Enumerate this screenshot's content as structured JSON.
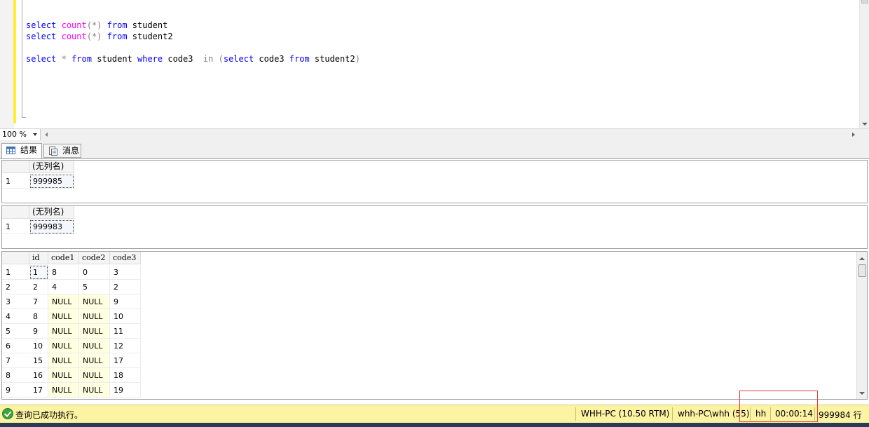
{
  "editor": {
    "lines": [
      [
        {
          "t": "select",
          "c": "kw"
        },
        {
          "t": " ",
          "c": "id"
        },
        {
          "t": "count",
          "c": "fn"
        },
        {
          "t": "(*)",
          "c": "op"
        },
        {
          "t": " ",
          "c": "id"
        },
        {
          "t": "from",
          "c": "kw"
        },
        {
          "t": " student",
          "c": "id"
        }
      ],
      [
        {
          "t": "select",
          "c": "kw"
        },
        {
          "t": " ",
          "c": "id"
        },
        {
          "t": "count",
          "c": "fn"
        },
        {
          "t": "(*)",
          "c": "op"
        },
        {
          "t": " ",
          "c": "id"
        },
        {
          "t": "from",
          "c": "kw"
        },
        {
          "t": " student2",
          "c": "id"
        }
      ],
      [],
      [
        {
          "t": "select",
          "c": "kw"
        },
        {
          "t": " ",
          "c": "id"
        },
        {
          "t": "*",
          "c": "op"
        },
        {
          "t": " ",
          "c": "id"
        },
        {
          "t": "from",
          "c": "kw"
        },
        {
          "t": " student ",
          "c": "id"
        },
        {
          "t": "where",
          "c": "kw"
        },
        {
          "t": " code3  ",
          "c": "id"
        },
        {
          "t": "in",
          "c": "op"
        },
        {
          "t": " ",
          "c": "id"
        },
        {
          "t": "(",
          "c": "op"
        },
        {
          "t": "select",
          "c": "kw"
        },
        {
          "t": " code3 ",
          "c": "id"
        },
        {
          "t": "from",
          "c": "kw"
        },
        {
          "t": " student2",
          "c": "id"
        },
        {
          "t": ")",
          "c": "op"
        }
      ]
    ]
  },
  "zoom": {
    "value": "100 %"
  },
  "tabs": {
    "results": "结果",
    "messages": "消息"
  },
  "panel1": {
    "header": "(无列名)",
    "rownum": "1",
    "value": "999985"
  },
  "panel2": {
    "header": "(无列名)",
    "rownum": "1",
    "value": "999983"
  },
  "grid": {
    "columns": [
      "id",
      "code1",
      "code2",
      "code3"
    ],
    "rows": [
      [
        "1",
        "8",
        "0",
        "3"
      ],
      [
        "2",
        "4",
        "5",
        "2"
      ],
      [
        "7",
        "NULL",
        "NULL",
        "9"
      ],
      [
        "8",
        "NULL",
        "NULL",
        "10"
      ],
      [
        "9",
        "NULL",
        "NULL",
        "11"
      ],
      [
        "10",
        "NULL",
        "NULL",
        "12"
      ],
      [
        "15",
        "NULL",
        "NULL",
        "17"
      ],
      [
        "16",
        "NULL",
        "NULL",
        "18"
      ],
      [
        "17",
        "NULL",
        "NULL",
        "19"
      ]
    ]
  },
  "status": {
    "message": "查询已成功执行。",
    "server": "WHH-PC (10.50 RTM)",
    "login": "whh-PC\\whh (55)",
    "database": "hh",
    "elapsed": "00:00:14",
    "rows": "999984 行"
  },
  "colors": {
    "keyword": "#0000ff",
    "function": "#ff00ff",
    "operator": "#808080",
    "statusbar": "#fcf3a3",
    "null_cell": "#ffffe1"
  }
}
